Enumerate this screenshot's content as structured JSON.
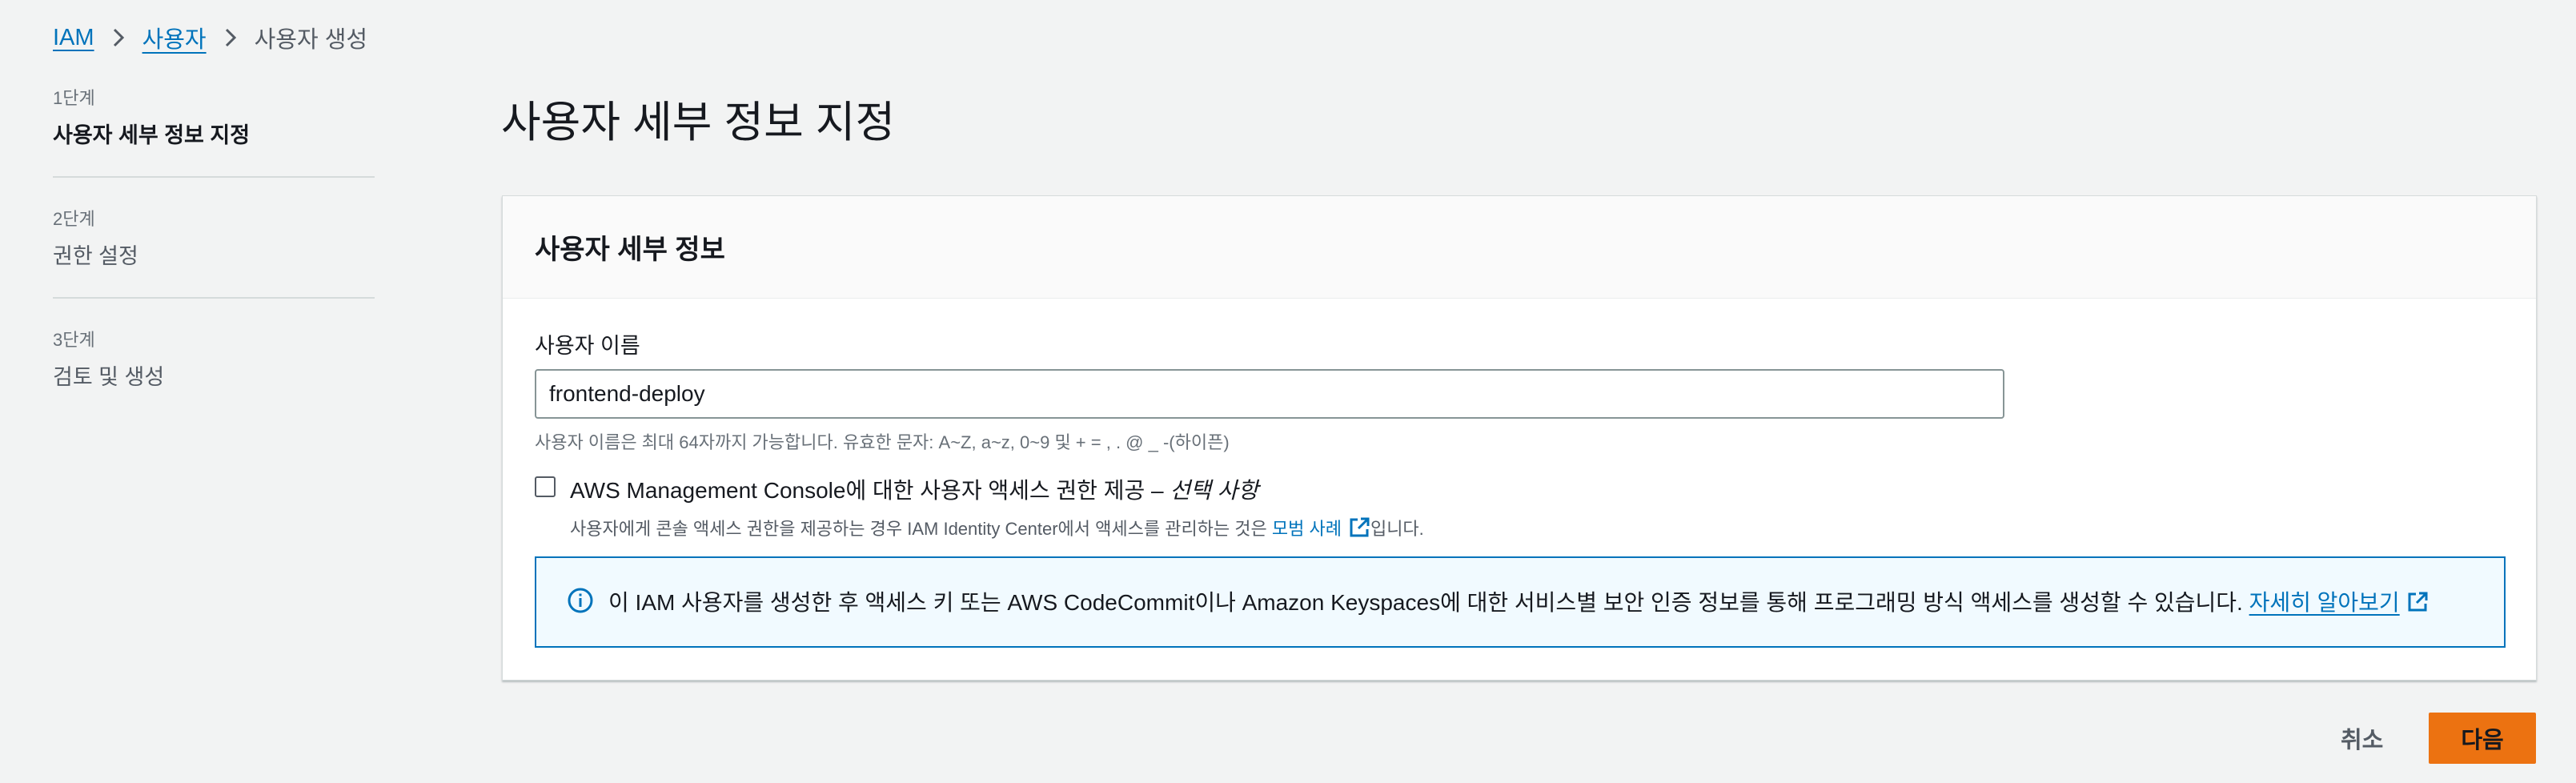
{
  "breadcrumb": {
    "items": [
      "IAM",
      "사용자"
    ],
    "current": "사용자 생성"
  },
  "wizard": {
    "steps": [
      {
        "num": "1단계",
        "title": "사용자 세부 정보 지정"
      },
      {
        "num": "2단계",
        "title": "권한 설정"
      },
      {
        "num": "3단계",
        "title": "검토 및 생성"
      }
    ]
  },
  "page": {
    "title": "사용자 세부 정보 지정"
  },
  "details": {
    "header": "사용자 세부 정보",
    "username_label": "사용자 이름",
    "username_value": "frontend-deploy",
    "username_constraint": "사용자 이름은 최대 64자까지 가능합니다. 유효한 문자: A~Z, a~z, 0~9 및 + = , . @ _ -(하이픈)",
    "console_access_label": "AWS Management Console에 대한 사용자 액세스 권한 제공 – ",
    "console_access_optional": "선택 사항",
    "console_access_desc_prefix": "사용자에게 콘솔 액세스 권한을 제공하는 경우 IAM Identity Center에서 액세스를 관리하는 것은 ",
    "console_access_desc_link": "모범 사례",
    "console_access_desc_suffix": "입니다.",
    "info_text": "이 IAM 사용자를 생성한 후 액세스 키 또는 AWS CodeCommit이나 Amazon Keyspaces에 대한 서비스별 보안 인증 정보를 통해 프로그래밍 방식 액세스를 생성할 수 있습니다. ",
    "info_link": "자세히 알아보기"
  },
  "footer": {
    "cancel_label": "취소",
    "next_label": "다음"
  },
  "colors": {
    "link": "#0073bb",
    "primary_button": "#ec7211",
    "info_border": "#0073bb",
    "info_background": "#f1faff"
  },
  "icons": {
    "breadcrumb_separator": "chevron-right-icon",
    "external_link": "external-link-icon",
    "info": "info-icon"
  }
}
